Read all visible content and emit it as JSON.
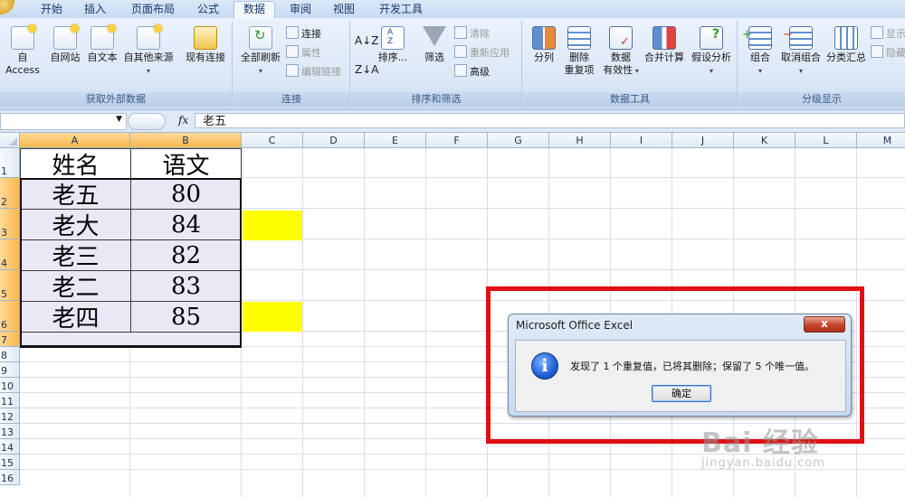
{
  "ribbon_tabs": [
    "开始",
    "插入",
    "页面布局",
    "公式",
    "数据",
    "审阅",
    "视图",
    "开发工具"
  ],
  "active_tab": "数据",
  "ribbon": {
    "get_external": {
      "label": "获取外部数据",
      "buttons": [
        "自 Access",
        "自网站",
        "自文本",
        "自其他来源",
        "现有连接"
      ]
    },
    "connections": {
      "label": "连接",
      "refresh_all": "全部刷新",
      "connections": "连接",
      "properties": "属性",
      "edit_links": "编辑链接"
    },
    "sort_filter": {
      "label": "排序和筛选",
      "sort": "排序...",
      "filter": "筛选",
      "clear": "清除",
      "reapply": "重新应用",
      "advanced": "高级"
    },
    "data_tools": {
      "label": "数据工具",
      "split": "分列",
      "remove_dup_1": "删除",
      "remove_dup_2": "重复项",
      "validation_1": "数据",
      "validation_2": "有效性",
      "consolidate": "合并计算",
      "what_if": "假设分析"
    },
    "outline": {
      "label": "分级显示",
      "group": "组合",
      "ungroup": "取消组合",
      "subtotal": "分类汇总",
      "show": "显示",
      "hide": "隐藏"
    }
  },
  "formula_bar": {
    "fx": "fx",
    "value": "老五"
  },
  "columns": [
    "A",
    "B",
    "C",
    "D",
    "E",
    "F",
    "G",
    "H",
    "I",
    "J",
    "K",
    "L",
    "M"
  ],
  "rows": [
    "1",
    "2",
    "3",
    "4",
    "5",
    "6",
    "7",
    "8",
    "9",
    "10",
    "11",
    "12",
    "13",
    "14",
    "15",
    "16"
  ],
  "table": {
    "headers": [
      "姓名",
      "语文"
    ],
    "rows": [
      [
        "老五",
        "80"
      ],
      [
        "老大",
        "84"
      ],
      [
        "老三",
        "82"
      ],
      [
        "老二",
        "83"
      ],
      [
        "老四",
        "85"
      ]
    ]
  },
  "highlight_color": "#ffff00",
  "dialog": {
    "title": "Microsoft Office Excel",
    "close": "x",
    "message": "发现了 1 个重复值，已将其删除；保留了 5 个唯一值。",
    "ok": "确定",
    "frame_color": "#e01010"
  },
  "watermark": {
    "main": "Bai 经验",
    "sub": "jingyan.baidu.com"
  }
}
